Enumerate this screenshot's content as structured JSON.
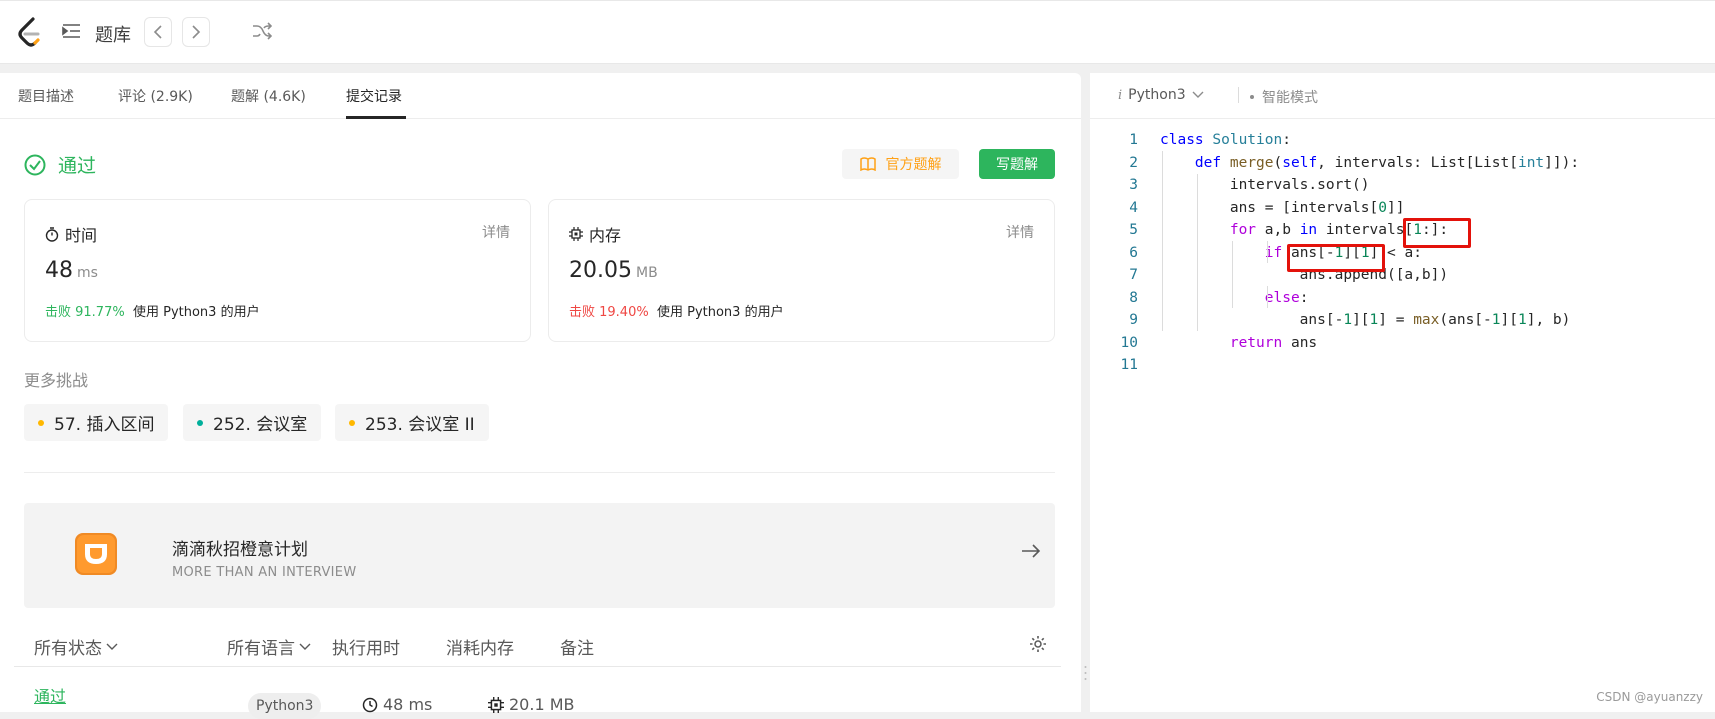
{
  "topbar": {
    "title": "题库"
  },
  "tabs": [
    {
      "label": "题目描述"
    },
    {
      "label": "评论 (2.9K)"
    },
    {
      "label": "题解 (4.6K)"
    },
    {
      "label": "提交记录"
    }
  ],
  "result": {
    "status": "通过",
    "official_btn": "官方题解",
    "write_btn": "写题解",
    "time": {
      "label": "时间",
      "detail": "详情",
      "value": "48",
      "unit": "ms",
      "beat_pct": "击败 91.77%",
      "beat_text": "使用 Python3 的用户"
    },
    "memory": {
      "label": "内存",
      "detail": "详情",
      "value": "20.05",
      "unit": "MB",
      "beat_pct": "击败 19.40%",
      "beat_text": "使用 Python3 的用户"
    }
  },
  "more": {
    "title": "更多挑战",
    "items": [
      {
        "label": "57. 插入区间",
        "color": "#ffb800"
      },
      {
        "label": "252. 会议室",
        "color": "#00af9b"
      },
      {
        "label": "253. 会议室 II",
        "color": "#ffb800"
      }
    ]
  },
  "banner": {
    "title": "滴滴秋招橙意计划",
    "subtitle": "MORE THAN AN INTERVIEW"
  },
  "table": {
    "headers": [
      "所有状态",
      "所有语言",
      "执行用时",
      "消耗内存",
      "备注"
    ],
    "row": {
      "status": "通过",
      "language": "Python3",
      "time": "48 ms",
      "memory": "20.1 MB"
    }
  },
  "editor": {
    "language": "Python3",
    "mode": "智能模式",
    "line_numbers": [
      "1",
      "2",
      "3",
      "4",
      "5",
      "6",
      "7",
      "8",
      "9",
      "10",
      "11"
    ]
  },
  "watermark": "CSDN @ayuanzzy",
  "colors": {
    "accept": "#2db55d",
    "fail": "#ef4743",
    "accent": "#ffa116"
  }
}
